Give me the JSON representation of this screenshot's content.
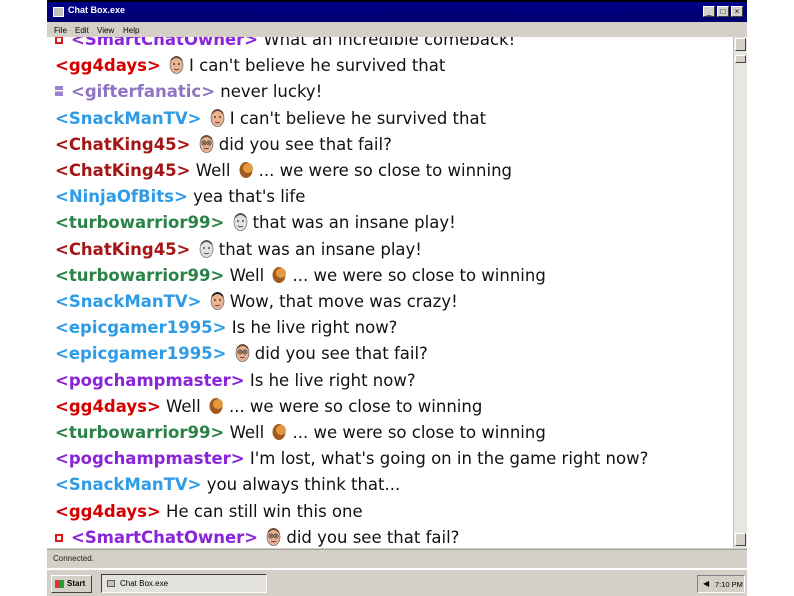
{
  "window": {
    "title": "Chat Box.exe",
    "buttons": [
      "_",
      "□",
      "×"
    ]
  },
  "menu": [
    "File",
    "Edit",
    "View",
    "Help"
  ],
  "colors": {
    "red": "#d40000",
    "darkred": "#a41515",
    "blue": "#2d9be6",
    "green": "#2a8246",
    "purple": "#8a24d8",
    "lilac": "#8f74c4"
  },
  "chat": {
    "messages": [
      {
        "user": "<SmartChatOwner>",
        "color": "purple",
        "badge": "red-square-badge",
        "emote": null,
        "text": "What an incredible comeback!"
      },
      {
        "user": "<gg4days>",
        "color": "red",
        "badge": null,
        "emote": "bald-man",
        "text": "I can't believe he survived that"
      },
      {
        "user": "<gifterfanatic>",
        "color": "lilac",
        "badge": "gift-badge",
        "emote": null,
        "text": "never lucky!"
      },
      {
        "user": "<SnackManTV>",
        "color": "blue",
        "badge": null,
        "emote": "bald-man",
        "text": "I can't believe he survived that"
      },
      {
        "user": "<ChatKing45>",
        "color": "darkred",
        "badge": null,
        "emote": "glasses-man",
        "text": "did you see that fail?"
      },
      {
        "user": "<ChatKing45>",
        "color": "darkred",
        "badge": null,
        "emote": null,
        "text": "Well",
        "emote_after": "facepalm",
        "text_after": "... we were so close to winning"
      },
      {
        "user": "<NinjaOfBits>",
        "color": "blue",
        "badge": null,
        "emote": null,
        "text": "yea that's life"
      },
      {
        "user": "<turbowarrior99>",
        "color": "green",
        "badge": null,
        "emote": "grey-face",
        "text": "that was an insane play!"
      },
      {
        "user": "<ChatKing45>",
        "color": "darkred",
        "badge": null,
        "emote": "grey-face",
        "text": "that was an insane play!"
      },
      {
        "user": "<turbowarrior99>",
        "color": "green",
        "badge": null,
        "emote": null,
        "text": "Well",
        "emote_after": "facepalm",
        "text_after": "... we were so close to winning"
      },
      {
        "user": "<SnackManTV>",
        "color": "blue",
        "badge": null,
        "emote": "dark-hair-man",
        "text": "Wow, that move was crazy!"
      },
      {
        "user": "<epicgamer1995>",
        "color": "blue",
        "badge": null,
        "emote": null,
        "text": "Is he live right now?"
      },
      {
        "user": "<epicgamer1995>",
        "color": "blue",
        "badge": null,
        "emote": "glasses-man",
        "text": "did you see that fail?"
      },
      {
        "user": "<pogchampmaster>",
        "color": "purple",
        "badge": null,
        "emote": null,
        "text": "Is he live right now?"
      },
      {
        "user": "<gg4days>",
        "color": "red",
        "badge": null,
        "emote": null,
        "text": "Well",
        "emote_after": "facepalm",
        "text_after": "... we were so close to winning"
      },
      {
        "user": "<turbowarrior99>",
        "color": "green",
        "badge": null,
        "emote": null,
        "text": "Well",
        "emote_after": "facepalm",
        "text_after": "... we were so close to winning"
      },
      {
        "user": "<pogchampmaster>",
        "color": "purple",
        "badge": null,
        "emote": null,
        "text": "I'm lost, what's going on in the game right now?"
      },
      {
        "user": "<SnackManTV>",
        "color": "blue",
        "badge": null,
        "emote": null,
        "text": "you always think that..."
      },
      {
        "user": "<gg4days>",
        "color": "red",
        "badge": null,
        "emote": null,
        "text": "He can still win this one"
      },
      {
        "user": "<SmartChatOwner>",
        "color": "purple",
        "badge": "red-square-badge",
        "emote": "glasses-man",
        "text": "did you see that fail?"
      }
    ]
  },
  "status": "Connected.",
  "taskbar": {
    "start_label": "Start",
    "task_label": "Chat Box.exe",
    "clock": "7:10 PM"
  }
}
